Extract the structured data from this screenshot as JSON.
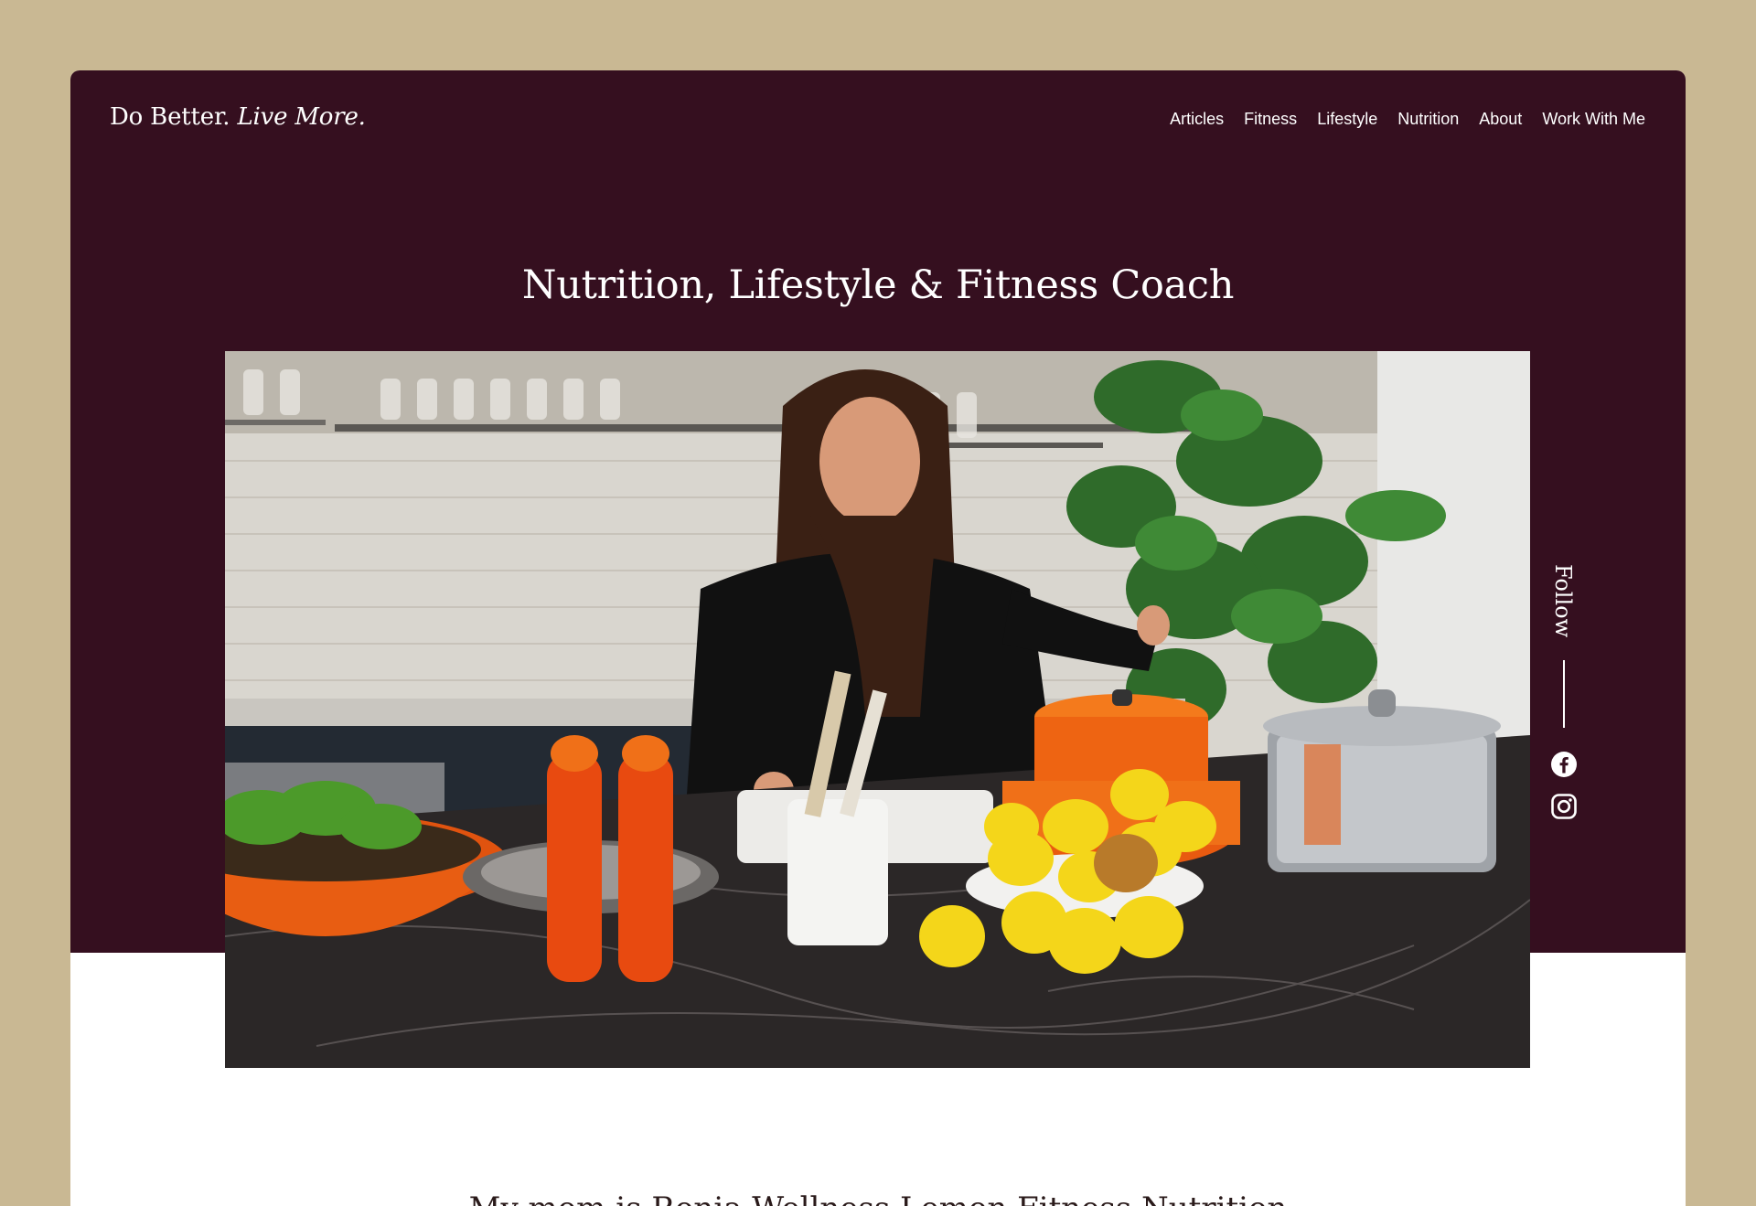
{
  "header": {
    "logo_regular": "Do Better.",
    "logo_italic": "Live More."
  },
  "nav": {
    "items": [
      "Articles",
      "Fitness",
      "Lifestyle",
      "Nutrition",
      "About",
      "Work With Me"
    ]
  },
  "hero": {
    "title": "Nutrition, Lifestyle & Fitness Coach",
    "image_alt": "Woman preparing food in a kitchen with orange cookware and lemons"
  },
  "social": {
    "follow_label": "Follow",
    "icons": [
      "facebook-icon",
      "instagram-icon"
    ]
  },
  "intro": {
    "text": "My mom is Ronia Wellness Lemon Fitness Nutrition"
  },
  "colors": {
    "page_background": "#c9b893",
    "hero_band": "#350f1f",
    "text_light": "#ffffff"
  }
}
